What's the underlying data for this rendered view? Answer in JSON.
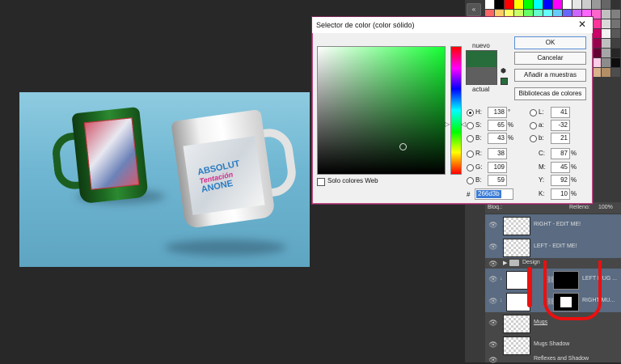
{
  "dialog": {
    "title": "Selector de color (color sólido)",
    "close_glyph": "✕",
    "label_new": "nuevo",
    "label_current": "actual",
    "new_color": "#266d3b",
    "current_color": "#5f5f5f",
    "buttons": {
      "ok": "OK",
      "cancel": "Cancelar",
      "add_swatch": "Añadir a muestras",
      "libraries": "Bibliotecas de colores"
    },
    "web_only_label": "Solo colores Web",
    "hex_label": "#",
    "hex_value": "266d3b",
    "fields_left": [
      {
        "label": "H:",
        "value": "138",
        "unit": "°",
        "selected": true
      },
      {
        "label": "S:",
        "value": "65",
        "unit": "%",
        "selected": false
      },
      {
        "label": "B:",
        "value": "43",
        "unit": "%",
        "selected": false
      },
      {
        "label": "R:",
        "value": "38",
        "unit": "",
        "selected": false
      },
      {
        "label": "G:",
        "value": "109",
        "unit": "",
        "selected": false
      },
      {
        "label": "B:",
        "value": "59",
        "unit": "",
        "selected": false
      }
    ],
    "fields_lab": [
      {
        "label": "L:",
        "value": "41"
      },
      {
        "label": "a:",
        "value": "-32"
      },
      {
        "label": "b:",
        "value": "21"
      }
    ],
    "fields_cmyk": [
      {
        "label": "C:",
        "value": "87",
        "unit": "%"
      },
      {
        "label": "M:",
        "value": "45",
        "unit": "%"
      },
      {
        "label": "Y:",
        "value": "92",
        "unit": "%"
      },
      {
        "label": "K:",
        "value": "10",
        "unit": "%"
      }
    ]
  },
  "layers": {
    "header_left": "Bloq.:",
    "header_fill": "Relleno:",
    "header_fill_value": "100%",
    "items": [
      {
        "name": "RIGHT - EDIT ME!",
        "selected": true
      },
      {
        "name": "LEFT - EDIT ME!",
        "selected": true
      },
      {
        "name": "Design",
        "folder": true
      },
      {
        "name": "LEFT MUG ...",
        "selected": true
      },
      {
        "name": "RIGHT MU...",
        "selected": true
      },
      {
        "name": "Mugs",
        "underline": true
      },
      {
        "name": "Mugs Shadow"
      },
      {
        "name": "Reflexes and Shadow"
      }
    ]
  },
  "artwork": {
    "mug_text_line1": "ABSOLUT",
    "mug_text_line2": "Tentación",
    "mug_text_line3": "ANONE"
  },
  "swatch_colors": [
    "#ffffff",
    "#000000",
    "#ff0000",
    "#ffff00",
    "#00ff00",
    "#00ffff",
    "#0000ff",
    "#ff00ff",
    "#ffffff",
    "#e6e6e6",
    "#cccccc",
    "#999999",
    "#666666",
    "#333333",
    "#ff6666",
    "#ffcc66",
    "#ffff66",
    "#ccff66",
    "#66ff66",
    "#66ffcc",
    "#66ffff",
    "#66ccff",
    "#6666ff",
    "#cc66ff",
    "#ff66ff",
    "#ff66cc",
    "#c0c0c0",
    "#808080",
    "#ff3333",
    "#ff9933",
    "#ffff33",
    "#99ff33",
    "#33ff33",
    "#33ff99",
    "#33ffff",
    "#3399ff",
    "#3333ff",
    "#9933ff",
    "#ff33ff",
    "#ff3399",
    "#d9d9d9",
    "#737373",
    "#cc0000",
    "#cc6600",
    "#cccc00",
    "#66cc00",
    "#00cc00",
    "#00cc66",
    "#00cccc",
    "#0066cc",
    "#0000cc",
    "#6600cc",
    "#cc00cc",
    "#cc0066",
    "#f2f2f2",
    "#595959",
    "#990000",
    "#994c00",
    "#999900",
    "#4c9900",
    "#009900",
    "#00994c",
    "#009999",
    "#004c99",
    "#000099",
    "#4c0099",
    "#990099",
    "#99004c",
    "#bfbfbf",
    "#404040",
    "#660000",
    "#663300",
    "#666600",
    "#336600",
    "#006600",
    "#006633",
    "#006666",
    "#003366",
    "#000066",
    "#330066",
    "#660066",
    "#660033",
    "#a6a6a6",
    "#262626",
    "#ffd9d9",
    "#ffe6cc",
    "#ffffcc",
    "#e6ffcc",
    "#ccffcc",
    "#ccffe6",
    "#ccffff",
    "#cce6ff",
    "#ccccff",
    "#e6ccff",
    "#ffccff",
    "#ffcce6",
    "#8c8c8c",
    "#0d0d0d",
    "#c8a278",
    "#a67c52",
    "#8c6239",
    "#754c24",
    "#603913",
    "#c7b299",
    "#998675",
    "#736357",
    "#534741",
    "#37302d",
    "#ecd9c6",
    "#d9b38c",
    "#b38f66",
    "#4d4d4d"
  ]
}
